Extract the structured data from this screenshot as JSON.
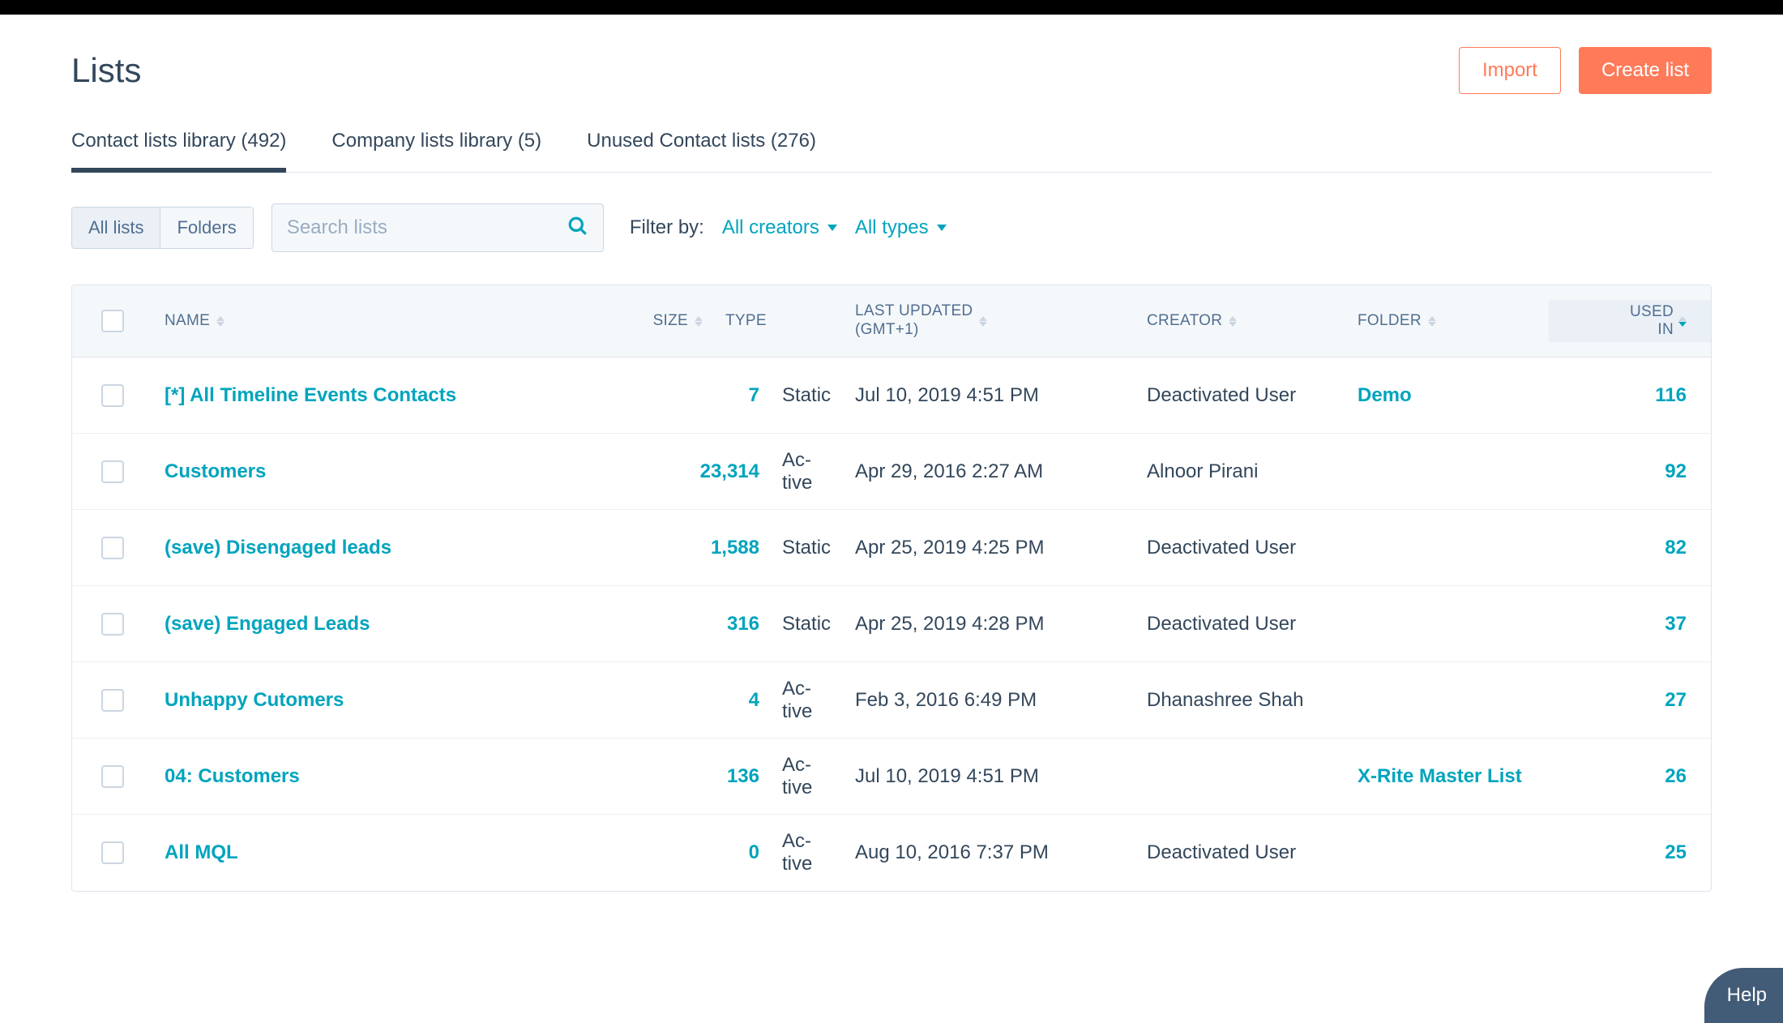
{
  "page": {
    "title": "Lists"
  },
  "header_buttons": {
    "import": "Import",
    "create": "Create list"
  },
  "tabs": [
    {
      "label": "Contact lists library (492)"
    },
    {
      "label": "Company lists library (5)"
    },
    {
      "label": "Unused Contact lists (276)"
    }
  ],
  "view_toggle": {
    "all": "All lists",
    "folders": "Folders"
  },
  "search": {
    "placeholder": "Search lists"
  },
  "filters": {
    "label": "Filter by:",
    "creators": "All creators",
    "types": "All types"
  },
  "columns": {
    "name": "NAME",
    "size": "SIZE",
    "type": "TYPE",
    "updated_l1": "LAST UPDATED",
    "updated_l2": "(GMT+1)",
    "creator": "CREATOR",
    "folder": "FOLDER",
    "used_l1": "USED",
    "used_l2": "IN"
  },
  "rows": [
    {
      "name": "[*] All Timeline Events Contacts",
      "size": "7",
      "type": "Static",
      "updated": "Jul 10, 2019 4:51 PM",
      "creator": "Deactivated User",
      "folder": "Demo",
      "used": "116"
    },
    {
      "name": "Customers",
      "size": "23,314",
      "type": "Ac­tive",
      "updated": "Apr 29, 2016 2:27 AM",
      "creator": "Alnoor Pirani",
      "folder": "",
      "used": "92"
    },
    {
      "name": "(save) Disengaged leads",
      "size": "1,588",
      "type": "Static",
      "updated": "Apr 25, 2019 4:25 PM",
      "creator": "Deactivated User",
      "folder": "",
      "used": "82"
    },
    {
      "name": "(save) Engaged Leads",
      "size": "316",
      "type": "Static",
      "updated": "Apr 25, 2019 4:28 PM",
      "creator": "Deactivated User",
      "folder": "",
      "used": "37"
    },
    {
      "name": "Unhappy Cutomers",
      "size": "4",
      "type": "Ac­tive",
      "updated": "Feb 3, 2016 6:49 PM",
      "creator": "Dhanashree Shah",
      "folder": "",
      "used": "27"
    },
    {
      "name": "04: Customers",
      "size": "136",
      "type": "Ac­tive",
      "updated": "Jul 10, 2019 4:51 PM",
      "creator": "",
      "folder": "X-Rite Master List",
      "used": "26"
    },
    {
      "name": "All MQL",
      "size": "0",
      "type": "Ac­tive",
      "updated": "Aug 10, 2016 7:37 PM",
      "creator": "Deactivated User",
      "folder": "",
      "used": "25"
    }
  ],
  "help": {
    "label": "Help"
  }
}
